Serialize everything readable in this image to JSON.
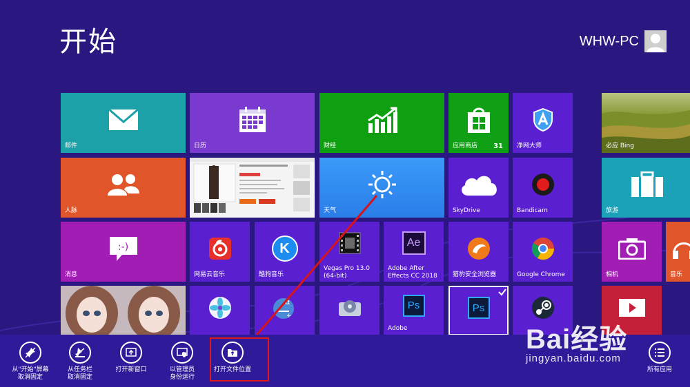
{
  "screen": {
    "title": "开始",
    "user_name": "WHW-PC"
  },
  "tiles": {
    "mail": "邮件",
    "calendar": "日历",
    "finance": "财经",
    "store": "应用商店",
    "store_badge": "31",
    "netguard": "净网大师",
    "bing": "必应 Bing",
    "people": "人脉",
    "weather": "天气",
    "skydrive": "SkyDrive",
    "bandicam": "Bandicam",
    "travel": "旅游",
    "messaging": "消息",
    "netease_music": "网易云音乐",
    "kugou_music": "酷狗音乐",
    "vegas_line1": "Vegas Pro 13.0",
    "vegas_line2": "(64-bit)",
    "ae_line1": "Adobe After",
    "ae_line2": "Effects CC 2018",
    "liebao": "猎豹安全浏览器",
    "chrome": "Google Chrome",
    "camera": "相机",
    "music": "音乐",
    "adobe": "Adobe",
    "ae_glyph": "Ae",
    "ps_glyph": "Ps",
    "kugou_glyph": "K"
  },
  "appbar": {
    "unpin_start_1": "从\"开始\"屏幕",
    "unpin_start_2": "取消固定",
    "unpin_taskbar_1": "从任务栏",
    "unpin_taskbar_2": "取消固定",
    "new_window": "打开新窗口",
    "run_admin_1": "以管理员",
    "run_admin_2": "身份运行",
    "open_location": "打开文件位置",
    "all_apps": "所有应用"
  },
  "watermark": {
    "brand": "Bai经验",
    "url": "jingyan.baidu.com"
  },
  "colors": {
    "background": "#2a1780",
    "mail": "#1ba1a7",
    "calendar": "#7a3ad0",
    "finance": "#0fa011",
    "store": "#10a015",
    "people": "#e0552a",
    "weather": "#2a8af0",
    "purple_tile": "#5a1fd0",
    "magenta": "#a11db4",
    "highlight": "#e01818"
  }
}
